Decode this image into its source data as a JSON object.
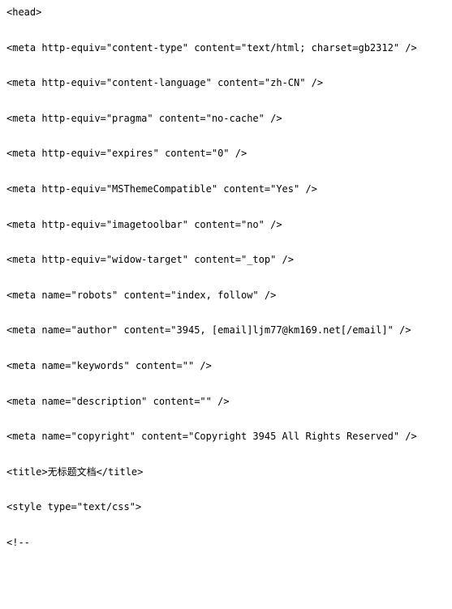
{
  "lines": [
    "<head>",
    "<meta http-equiv=\"content-type\" content=\"text/html; charset=gb2312\" />",
    "<meta http-equiv=\"content-language\" content=\"zh-CN\" />",
    "<meta http-equiv=\"pragma\" content=\"no-cache\" />",
    "<meta http-equiv=\"expires\" content=\"0\" />",
    "<meta http-equiv=\"MSThemeCompatible\" content=\"Yes\" />",
    "<meta http-equiv=\"imagetoolbar\" content=\"no\" />",
    "<meta http-equiv=\"widow-target\" content=\"_top\" />",
    "<meta name=\"robots\" content=\"index, follow\" />",
    "<meta name=\"author\" content=\"3945, [email]ljm77@km169.net[/email]\" />",
    "<meta name=\"keywords\" content=\"\" />",
    "<meta name=\"description\" content=\"\" />",
    "<meta name=\"copyright\" content=\"Copyright 3945 All Rights Reserved\" />",
    "<title>无标题文档</title>",
    "<style type=\"text/css\">",
    "<!--"
  ]
}
